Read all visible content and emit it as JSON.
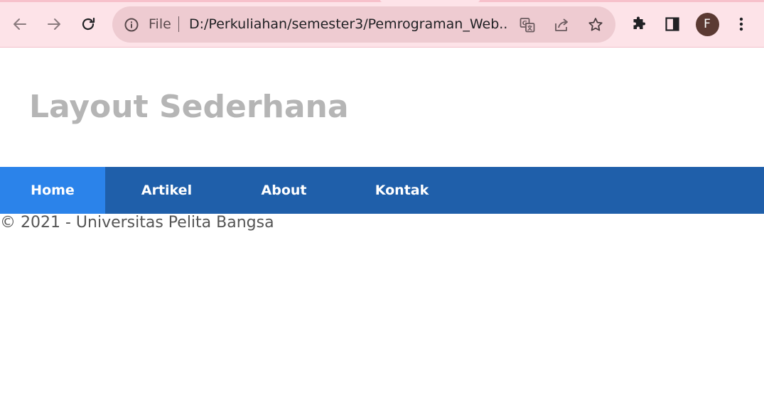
{
  "browser": {
    "scheme_label": "File",
    "url": "D:/Perkuliahan/semester3/Pemrograman_Web...",
    "profile_initial": "F",
    "icons": {
      "back": "arrow-left-icon",
      "forward": "arrow-right-icon",
      "reload": "reload-icon",
      "info": "info-icon",
      "translate": "translate-icon",
      "share": "share-icon",
      "bookmark": "star-icon",
      "extensions": "puzzle-icon",
      "side_panel": "side-panel-icon",
      "menu": "kebab-menu-icon"
    },
    "colors": {
      "toolbar": "#fde3e8",
      "omnibox": "#eecbd1",
      "avatar": "#5b3a33"
    }
  },
  "site": {
    "title": "Layout Sederhana",
    "nav": [
      {
        "label": "Home",
        "active": true
      },
      {
        "label": "Artikel",
        "active": false
      },
      {
        "label": "About",
        "active": false
      },
      {
        "label": "Kontak",
        "active": false
      }
    ],
    "footer": "© 2021 - Universitas Pelita Bangsa",
    "colors": {
      "title": "#b5b5b5",
      "nav_background": "#1f5faa",
      "nav_active": "#2b83ea",
      "nav_text": "#ffffff",
      "footer_text": "#555555"
    }
  }
}
